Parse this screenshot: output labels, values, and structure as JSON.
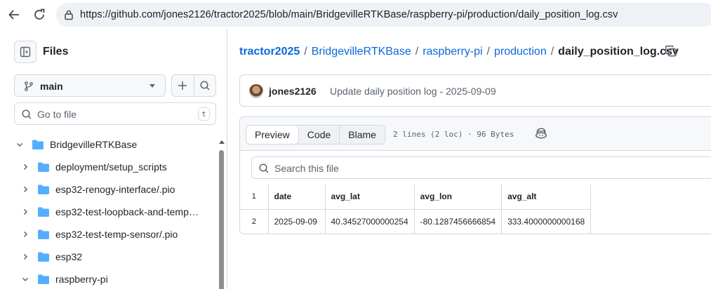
{
  "browser": {
    "url": "https://github.com/jones2126/tractor2025/blob/main/BridgevilleRTKBase/raspberry-pi/production/daily_position_log.csv"
  },
  "sidebar": {
    "title": "Files",
    "branch": "main",
    "goto_placeholder": "Go to file",
    "goto_shortcut": "t",
    "tree": [
      {
        "label": "BridgevilleRTKBase",
        "expanded": true,
        "depth": 0
      },
      {
        "label": "deployment/setup_scripts",
        "expanded": false,
        "depth": 1
      },
      {
        "label": "esp32-renogy-interface/.pio",
        "expanded": false,
        "depth": 1
      },
      {
        "label": "esp32-test-loopback-and-temp…",
        "expanded": false,
        "depth": 1
      },
      {
        "label": "esp32-test-temp-sensor/.pio",
        "expanded": false,
        "depth": 1
      },
      {
        "label": "esp32",
        "expanded": false,
        "depth": 1
      },
      {
        "label": "raspberry-pi",
        "expanded": true,
        "depth": 1
      }
    ]
  },
  "breadcrumb": {
    "repo": "tractor2025",
    "parts": [
      "BridgevilleRTKBase",
      "raspberry-pi",
      "production"
    ],
    "file": "daily_position_log.csv"
  },
  "commit": {
    "author": "jones2126",
    "message": "Update daily position log - 2025-09-09"
  },
  "file_view": {
    "tabs": [
      "Preview",
      "Code",
      "Blame"
    ],
    "active_tab": "Preview",
    "info": "2 lines (2 loc) · 96 Bytes",
    "search_placeholder": "Search this file"
  },
  "csv": {
    "headers": [
      "date",
      "avg_lat",
      "avg_lon",
      "avg_alt"
    ],
    "rows": [
      [
        "2025-09-09",
        "40.34527000000254",
        "-80.1287456666854",
        "333.4000000000168"
      ]
    ],
    "line_numbers": [
      "1",
      "2"
    ]
  },
  "colors": {
    "link": "#0969da",
    "folder": "#54aeff",
    "border": "#d1d9e0",
    "muted": "#59636e"
  }
}
